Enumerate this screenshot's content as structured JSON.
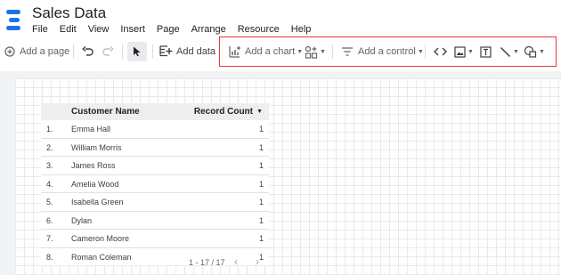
{
  "app": {
    "title": "Sales Data"
  },
  "menu": [
    "File",
    "Edit",
    "View",
    "Insert",
    "Page",
    "Arrange",
    "Resource",
    "Help"
  ],
  "toolbar": {
    "add_page": "Add a page",
    "add_data": "Add data",
    "add_chart": "Add a chart",
    "add_control": "Add a control"
  },
  "icons": {
    "logo": "report-logo-icon",
    "add_page": "add-circle-icon",
    "undo": "undo-icon",
    "redo": "redo-icon",
    "select": "cursor-icon",
    "add_data": "add-data-icon",
    "add_chart": "add-chart-icon",
    "community": "community-viz-icon",
    "control": "filter-lines-icon",
    "embed": "code-icon",
    "image": "image-icon",
    "text": "text-box-icon",
    "line": "line-icon",
    "shape": "shape-icon"
  },
  "colors": {
    "highlight": "#e53935",
    "logo_blue": "#1a73e8",
    "header_bg": "#eeeeee"
  },
  "table": {
    "columns": [
      "Customer Name",
      "Record Count"
    ],
    "sort_indicator": "▼",
    "rows": [
      {
        "idx": "1.",
        "name": "Emma Hall",
        "count": "1"
      },
      {
        "idx": "2.",
        "name": "William Morris",
        "count": "1"
      },
      {
        "idx": "3.",
        "name": "James Ross",
        "count": "1"
      },
      {
        "idx": "4.",
        "name": "Amelia Wood",
        "count": "1"
      },
      {
        "idx": "5.",
        "name": "Isabella Green",
        "count": "1"
      },
      {
        "idx": "6.",
        "name": "Dylan",
        "count": "1"
      },
      {
        "idx": "7.",
        "name": "Cameron Moore",
        "count": "1"
      },
      {
        "idx": "8.",
        "name": "Roman Coleman",
        "count": "1"
      }
    ],
    "pagination": "1 - 17 / 17"
  }
}
